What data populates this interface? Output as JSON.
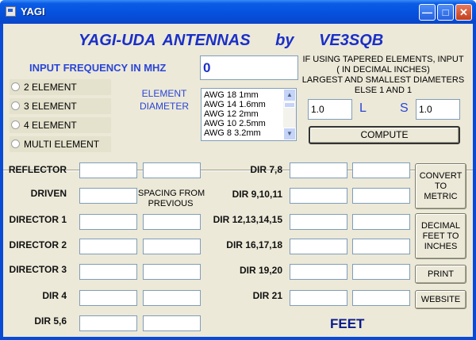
{
  "window": {
    "title": "YAGI"
  },
  "banner": {
    "part1": "YAGI-UDA ANTENNAS",
    "part2": "by",
    "part3": "VE3SQB"
  },
  "frequency": {
    "label": "INPUT FREQUENCY IN MHZ",
    "value": "0"
  },
  "element_options": [
    "2 ELEMENT",
    "3 ELEMENT",
    "4 ELEMENT",
    "MULTI ELEMENT"
  ],
  "diameter": {
    "label_line1": "ELEMENT",
    "label_line2": "DIAMETER",
    "list_items": [
      "AWG 18  1mm",
      "AWG 14  1.6mm",
      "AWG 12  2mm",
      "AWG 10  2.5mm",
      "AWG 8    3.2mm"
    ]
  },
  "tapered": {
    "line1": "IF USING TAPERED ELEMENTS, INPUT",
    "line2": "( IN DECIMAL INCHES)",
    "line3": "LARGEST AND SMALLEST DIAMETERS",
    "line4": "ELSE 1 AND 1",
    "large_label": "L",
    "large_value": "1.0",
    "small_label": "S",
    "small_value": "1.0"
  },
  "compute_label": "COMPUTE",
  "left_rows": [
    "REFLECTOR",
    "DRIVEN",
    "DIRECTOR 1",
    "DIRECTOR 2",
    "DIRECTOR 3",
    "DIR 4",
    "DIR 5,6"
  ],
  "spacing_label_line1": "SPACING FROM",
  "spacing_label_line2": "PREVIOUS",
  "right_rows": [
    "DIR 7,8",
    "DIR 9,10,11",
    "DIR 12,13,14,15",
    "DIR 16,17,18",
    "DIR 19,20",
    "DIR 21"
  ],
  "buttons": {
    "convert_line1": "CONVERT",
    "convert_line2": "TO",
    "convert_line3": "METRIC",
    "decimal_line1": "DECIMAL",
    "decimal_line2": "FEET TO",
    "decimal_line3": "INCHES",
    "print": "PRINT",
    "website": "WEBSITE"
  },
  "units_label": "FEET",
  "colors": {
    "banner": "#1a2fc8",
    "label_blue": "#2a45d8",
    "units": "#0a1a8c",
    "titlebar": "#0550dc"
  }
}
